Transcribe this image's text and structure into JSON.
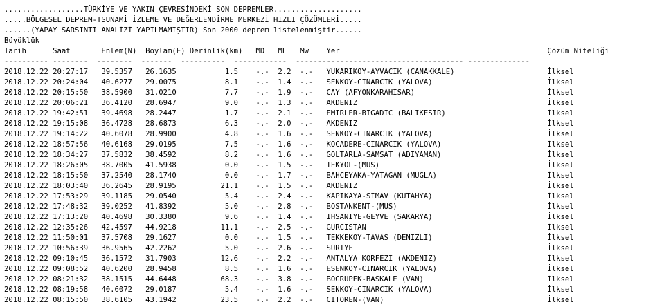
{
  "banner": [
    "..................TÜRKİYE VE YAKIN ÇEVRESİNDEKİ SON DEPREMLER....................",
    ".....BÖLGESEL DEPREM-TSUNAMİ İZLEME VE DEĞERLENDİRME MERKEZİ HIZLI ÇÖZÜMLERİ.....",
    "......(YAPAY SARSINTI ANALİZİ YAPILMAMIŞTIR) Son 2000 deprem listelenmiştir......"
  ],
  "magnitude_group_label": "Büyüklük",
  "columns": {
    "date": "Tarih",
    "time": "Saat",
    "lat": "Enlem(N)",
    "lon": "Boylam(E)",
    "depth": "Derinlik(km)",
    "md": "MD",
    "ml": "ML",
    "mw": "Mw",
    "place": "Yer",
    "quality": "Çözüm Niteliği"
  },
  "rows": [
    {
      "date": "2018.12.22",
      "time": "20:27:17",
      "lat": "39.5357",
      "lon": "26.1635",
      "depth": "1.5",
      "md": "-.-",
      "ml": "2.2",
      "mw": "-.-",
      "place": "YUKARIKOY-AYVACIK (CANAKKALE)",
      "quality": "İlksel"
    },
    {
      "date": "2018.12.22",
      "time": "20:24:04",
      "lat": "40.6277",
      "lon": "29.0075",
      "depth": "8.1",
      "md": "-.-",
      "ml": "1.4",
      "mw": "-.-",
      "place": "SENKOY-CINARCIK (YALOVA)",
      "quality": "İlksel"
    },
    {
      "date": "2018.12.22",
      "time": "20:15:50",
      "lat": "38.5900",
      "lon": "31.0210",
      "depth": "7.7",
      "md": "-.-",
      "ml": "1.9",
      "mw": "-.-",
      "place": "CAY (AFYONKARAHISAR)",
      "quality": "İlksel"
    },
    {
      "date": "2018.12.22",
      "time": "20:06:21",
      "lat": "36.4120",
      "lon": "28.6947",
      "depth": "9.0",
      "md": "-.-",
      "ml": "1.3",
      "mw": "-.-",
      "place": "AKDENIZ",
      "quality": "İlksel"
    },
    {
      "date": "2018.12.22",
      "time": "19:42:51",
      "lat": "39.4698",
      "lon": "28.2447",
      "depth": "1.7",
      "md": "-.-",
      "ml": "2.1",
      "mw": "-.-",
      "place": "EMIRLER-BIGADIC (BALIKESIR)",
      "quality": "İlksel"
    },
    {
      "date": "2018.12.22",
      "time": "19:15:08",
      "lat": "36.4728",
      "lon": "28.6873",
      "depth": "6.3",
      "md": "-.-",
      "ml": "2.0",
      "mw": "-.-",
      "place": "AKDENIZ",
      "quality": "İlksel"
    },
    {
      "date": "2018.12.22",
      "time": "19:14:22",
      "lat": "40.6078",
      "lon": "28.9900",
      "depth": "4.8",
      "md": "-.-",
      "ml": "1.6",
      "mw": "-.-",
      "place": "SENKOY-CINARCIK (YALOVA)",
      "quality": "İlksel"
    },
    {
      "date": "2018.12.22",
      "time": "18:57:56",
      "lat": "40.6168",
      "lon": "29.0195",
      "depth": "7.5",
      "md": "-.-",
      "ml": "1.6",
      "mw": "-.-",
      "place": "KOCADERE-CINARCIK (YALOVA)",
      "quality": "İlksel"
    },
    {
      "date": "2018.12.22",
      "time": "18:34:27",
      "lat": "37.5832",
      "lon": "38.4592",
      "depth": "8.2",
      "md": "-.-",
      "ml": "1.6",
      "mw": "-.-",
      "place": "GOLTARLA-SAMSAT (ADIYAMAN)",
      "quality": "İlksel"
    },
    {
      "date": "2018.12.22",
      "time": "18:26:05",
      "lat": "38.7005",
      "lon": "41.5938",
      "depth": "0.0",
      "md": "-.-",
      "ml": "1.5",
      "mw": "-.-",
      "place": "TEKYOL-(MUS)",
      "quality": "İlksel"
    },
    {
      "date": "2018.12.22",
      "time": "18:15:50",
      "lat": "37.2540",
      "lon": "28.1740",
      "depth": "0.0",
      "md": "-.-",
      "ml": "1.7",
      "mw": "-.-",
      "place": "BAHCEYAKA-YATAGAN (MUGLA)",
      "quality": "İlksel"
    },
    {
      "date": "2018.12.22",
      "time": "18:03:40",
      "lat": "36.2645",
      "lon": "28.9195",
      "depth": "21.1",
      "md": "-.-",
      "ml": "1.5",
      "mw": "-.-",
      "place": "AKDENIZ",
      "quality": "İlksel"
    },
    {
      "date": "2018.12.22",
      "time": "17:53:29",
      "lat": "39.1185",
      "lon": "29.0540",
      "depth": "5.4",
      "md": "-.-",
      "ml": "2.4",
      "mw": "-.-",
      "place": "KAPIKAYA-SIMAV (KUTAHYA)",
      "quality": "İlksel"
    },
    {
      "date": "2018.12.22",
      "time": "17:48:32",
      "lat": "39.0252",
      "lon": "41.8392",
      "depth": "5.0",
      "md": "-.-",
      "ml": "2.8",
      "mw": "-.-",
      "place": "BOSTANKENT-(MUS)",
      "quality": "İlksel"
    },
    {
      "date": "2018.12.22",
      "time": "17:13:20",
      "lat": "40.4698",
      "lon": "30.3380",
      "depth": "9.6",
      "md": "-.-",
      "ml": "1.4",
      "mw": "-.-",
      "place": "IHSANIYE-GEYVE (SAKARYA)",
      "quality": "İlksel"
    },
    {
      "date": "2018.12.22",
      "time": "12:35:26",
      "lat": "42.4597",
      "lon": "44.9218",
      "depth": "11.1",
      "md": "-.-",
      "ml": "2.5",
      "mw": "-.-",
      "place": "GURCISTAN",
      "quality": "İlksel"
    },
    {
      "date": "2018.12.22",
      "time": "11:50:01",
      "lat": "37.5708",
      "lon": "29.1627",
      "depth": "0.0",
      "md": "-.-",
      "ml": "1.5",
      "mw": "-.-",
      "place": "TEKKEKOY-TAVAS (DENIZLI)",
      "quality": "İlksel"
    },
    {
      "date": "2018.12.22",
      "time": "10:56:39",
      "lat": "36.9565",
      "lon": "42.2262",
      "depth": "5.0",
      "md": "-.-",
      "ml": "2.6",
      "mw": "-.-",
      "place": "SURIYE",
      "quality": "İlksel"
    },
    {
      "date": "2018.12.22",
      "time": "09:10:45",
      "lat": "36.1572",
      "lon": "31.7903",
      "depth": "12.6",
      "md": "-.-",
      "ml": "2.2",
      "mw": "-.-",
      "place": "ANTALYA KORFEZI (AKDENIZ)",
      "quality": "İlksel"
    },
    {
      "date": "2018.12.22",
      "time": "09:08:52",
      "lat": "40.6200",
      "lon": "28.9458",
      "depth": "8.5",
      "md": "-.-",
      "ml": "1.6",
      "mw": "-.-",
      "place": "ESENKOY-CINARCIK (YALOVA)",
      "quality": "İlksel"
    },
    {
      "date": "2018.12.22",
      "time": "08:21:32",
      "lat": "38.1515",
      "lon": "44.6448",
      "depth": "68.3",
      "md": "-.-",
      "ml": "3.8",
      "mw": "-.-",
      "place": "BOGRUPEK-BASKALE (VAN)",
      "quality": "İlksel"
    },
    {
      "date": "2018.12.22",
      "time": "08:19:58",
      "lat": "40.6072",
      "lon": "29.0187",
      "depth": "5.4",
      "md": "-.-",
      "ml": "1.6",
      "mw": "-.-",
      "place": "SENKOY-CINARCIK (YALOVA)",
      "quality": "İlksel"
    },
    {
      "date": "2018.12.22",
      "time": "08:15:50",
      "lat": "38.6105",
      "lon": "43.1942",
      "depth": "23.5",
      "md": "-.-",
      "ml": "2.2",
      "mw": "-.-",
      "place": "CITOREN-(VAN)",
      "quality": "İlksel"
    }
  ]
}
